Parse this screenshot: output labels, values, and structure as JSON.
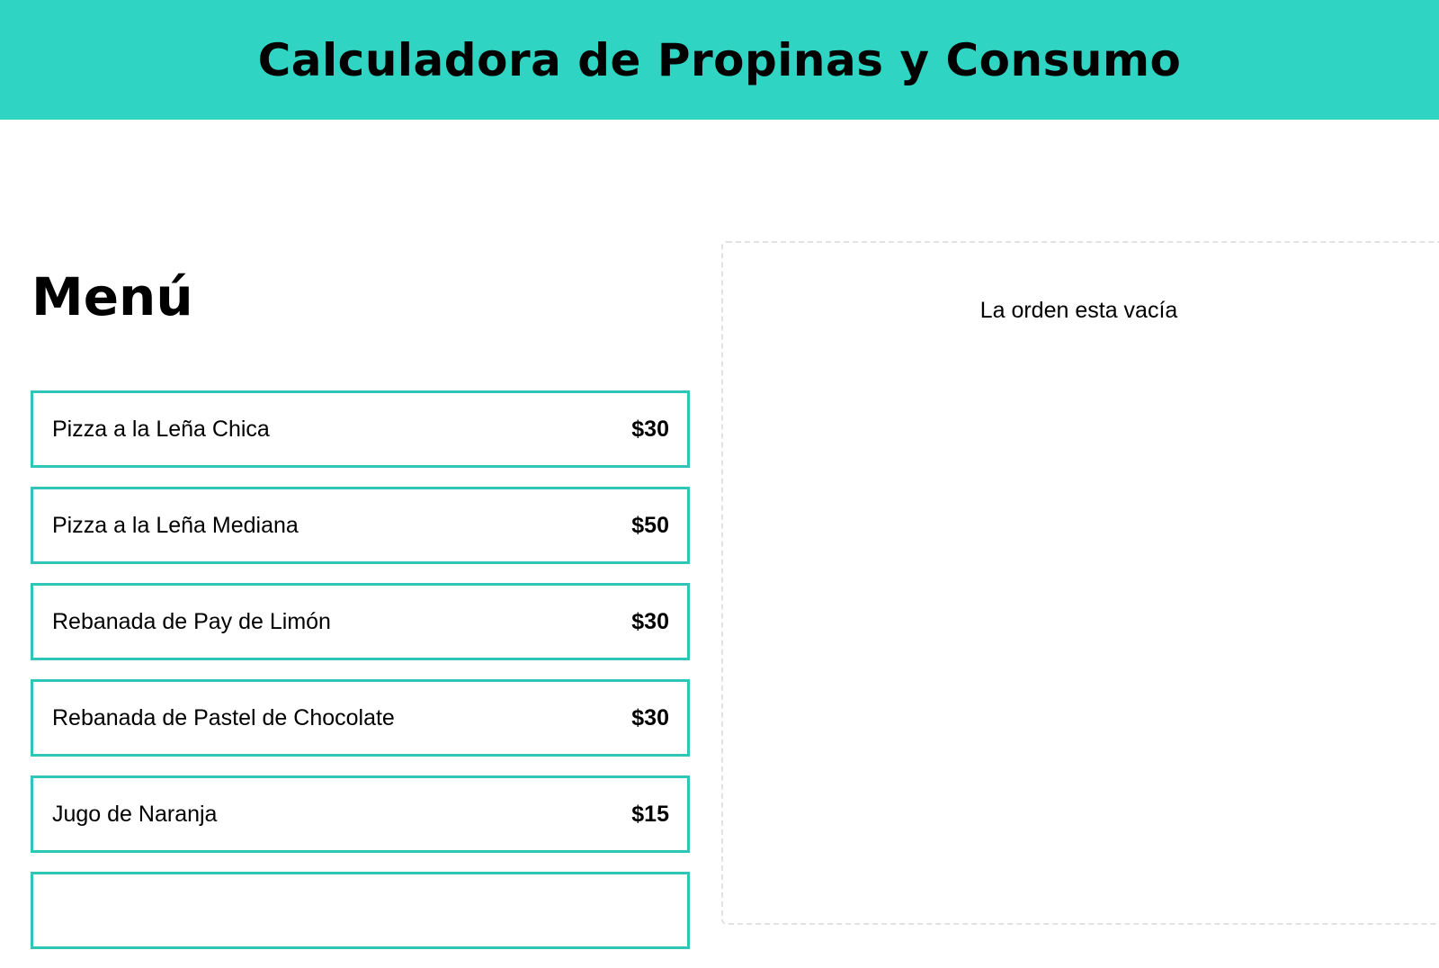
{
  "header": {
    "title": "Calculadora de Propinas y Consumo"
  },
  "menu": {
    "title": "Menú",
    "items": [
      {
        "name": "Pizza a la Leña Chica",
        "price": "$30"
      },
      {
        "name": "Pizza a la Leña Mediana",
        "price": "$50"
      },
      {
        "name": "Rebanada de Pay de Limón",
        "price": "$30"
      },
      {
        "name": "Rebanada de Pastel de Chocolate",
        "price": "$30"
      },
      {
        "name": "Jugo de Naranja",
        "price": "$15"
      }
    ]
  },
  "order": {
    "empty_message": "La orden esta vacía"
  },
  "colors": {
    "accent": "#2fd5c2",
    "item_border": "#2fc5b8"
  }
}
